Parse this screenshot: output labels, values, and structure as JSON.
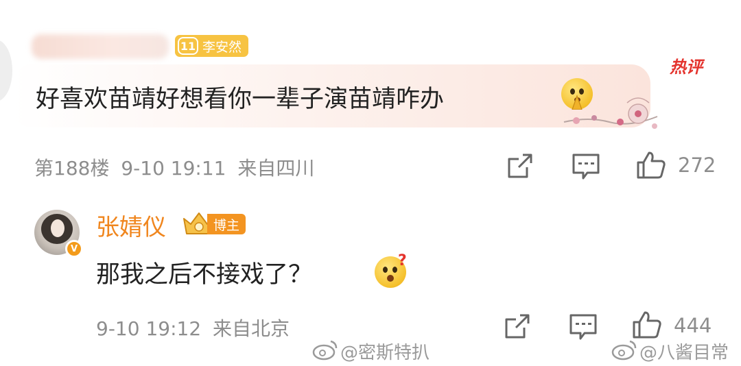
{
  "top_comment": {
    "fan_badge": {
      "level": "11",
      "name": "李安然"
    },
    "hot_tag": "热评",
    "content": "好喜欢苗靖好想看你一辈子演苗靖咋办",
    "floor": "第188楼",
    "time": "9-10 19:11",
    "location": "来自四川",
    "like_count": "272"
  },
  "reply": {
    "author": "张婧仪",
    "role_badge": "博主",
    "content": "那我之后不接戏了？",
    "time": "9-10 19:12",
    "location": "来自北京",
    "like_count": "444"
  },
  "watermarks": [
    "@密斯特扒",
    "@八酱目常"
  ],
  "icons": [
    "share-icon",
    "comment-icon",
    "like-icon",
    "emoji-pray-icon",
    "emoji-question-icon",
    "crown-icon",
    "weibo-logo-icon"
  ],
  "colors": {
    "hot": "#e4332d",
    "username": "#f0861e",
    "meta": "#8d8d8d",
    "badge": "#f39421"
  }
}
